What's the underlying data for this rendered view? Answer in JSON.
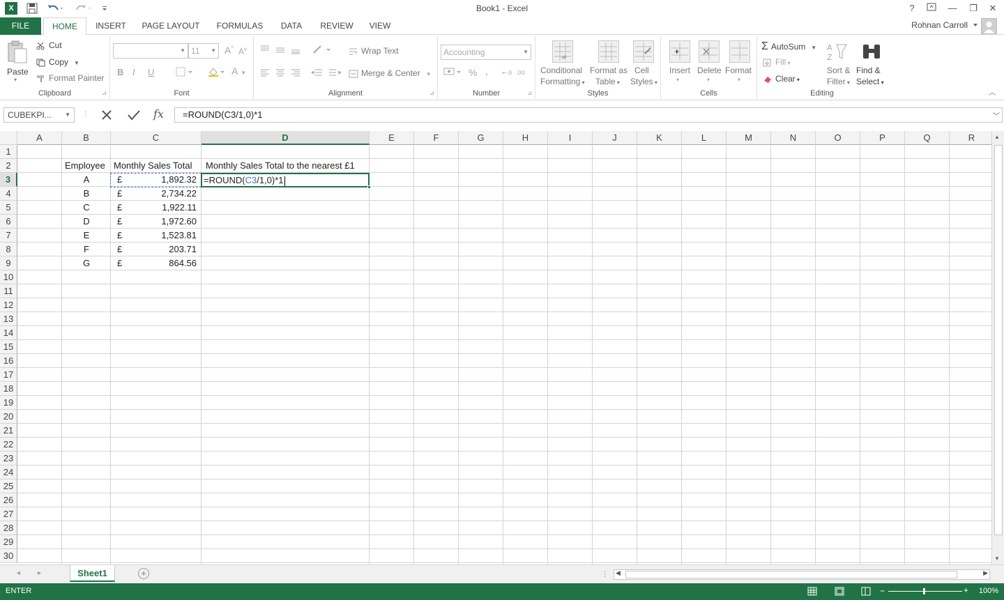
{
  "window": {
    "title": "Book1 - Excel",
    "help": "?",
    "minimize": "—",
    "restore": "❐",
    "close": "✕"
  },
  "ribbon": {
    "file_tab": "FILE",
    "tabs": [
      "HOME",
      "INSERT",
      "PAGE LAYOUT",
      "FORMULAS",
      "DATA",
      "REVIEW",
      "VIEW"
    ],
    "active_tab": "HOME",
    "user": "Rohnan Carroll",
    "clipboard": {
      "label": "Clipboard",
      "paste": "Paste",
      "cut": "Cut",
      "copy": "Copy",
      "format_painter": "Format Painter"
    },
    "font": {
      "label": "Font",
      "font_size": "11",
      "bold": "B",
      "italic": "I",
      "underline": "U"
    },
    "alignment": {
      "label": "Alignment",
      "wrap_text": "Wrap Text",
      "merge_center": "Merge & Center"
    },
    "number": {
      "label": "Number",
      "format": "Accounting",
      "percent": "%",
      "comma": ","
    },
    "styles": {
      "label": "Styles",
      "conditional_formatting": [
        "Conditional",
        "Formatting"
      ],
      "format_as_table": [
        "Format as",
        "Table"
      ],
      "cell_styles": [
        "Cell",
        "Styles"
      ]
    },
    "cells": {
      "label": "Cells",
      "insert": "Insert",
      "delete": "Delete",
      "format": "Format"
    },
    "editing": {
      "label": "Editing",
      "autosum": "AutoSum",
      "fill": "Fill",
      "clear": "Clear",
      "sort_filter": [
        "Sort &",
        "Filter"
      ],
      "find_select": [
        "Find &",
        "Select"
      ]
    }
  },
  "formula_bar": {
    "name_box": "CUBEKPI...",
    "fx": "fx",
    "formula": "=ROUND(C3/1,0)*1"
  },
  "grid": {
    "columns": [
      "A",
      "B",
      "C",
      "D",
      "E",
      "F",
      "G",
      "H",
      "I",
      "J",
      "K",
      "L",
      "M",
      "N",
      "O",
      "P",
      "Q",
      "R"
    ],
    "selected_column": "D",
    "selected_row": "3",
    "rows": [
      "1",
      "2",
      "3",
      "4",
      "5",
      "6",
      "7",
      "8",
      "9",
      "10",
      "11",
      "12",
      "13",
      "14",
      "15",
      "16",
      "17",
      "18",
      "19",
      "20",
      "21",
      "22",
      "23",
      "24",
      "25",
      "26",
      "27",
      "28",
      "29",
      "30"
    ],
    "headers": {
      "b2": "Employee",
      "c2": "Monthly Sales Total",
      "d2": "Monthly Sales Total to the nearest £1"
    },
    "currency_symbol": "£",
    "data": [
      {
        "employee": "A",
        "sales": "1,892.32"
      },
      {
        "employee": "B",
        "sales": "2,734.22"
      },
      {
        "employee": "C",
        "sales": "1,922.11"
      },
      {
        "employee": "D",
        "sales": "1,972.60"
      },
      {
        "employee": "E",
        "sales": "1,523.81"
      },
      {
        "employee": "F",
        "sales": "203.71"
      },
      {
        "employee": "G",
        "sales": "864.56"
      }
    ],
    "edit_cell": {
      "prefix": "=ROUND(",
      "ref": "C3",
      "suffix": "/1,0)*1"
    }
  },
  "sheets": {
    "tabs": [
      "Sheet1"
    ],
    "active": "Sheet1"
  },
  "status": {
    "mode": "ENTER",
    "zoom": "100%"
  },
  "colors": {
    "accent": "#217346",
    "ref_blue": "#4472c4"
  }
}
